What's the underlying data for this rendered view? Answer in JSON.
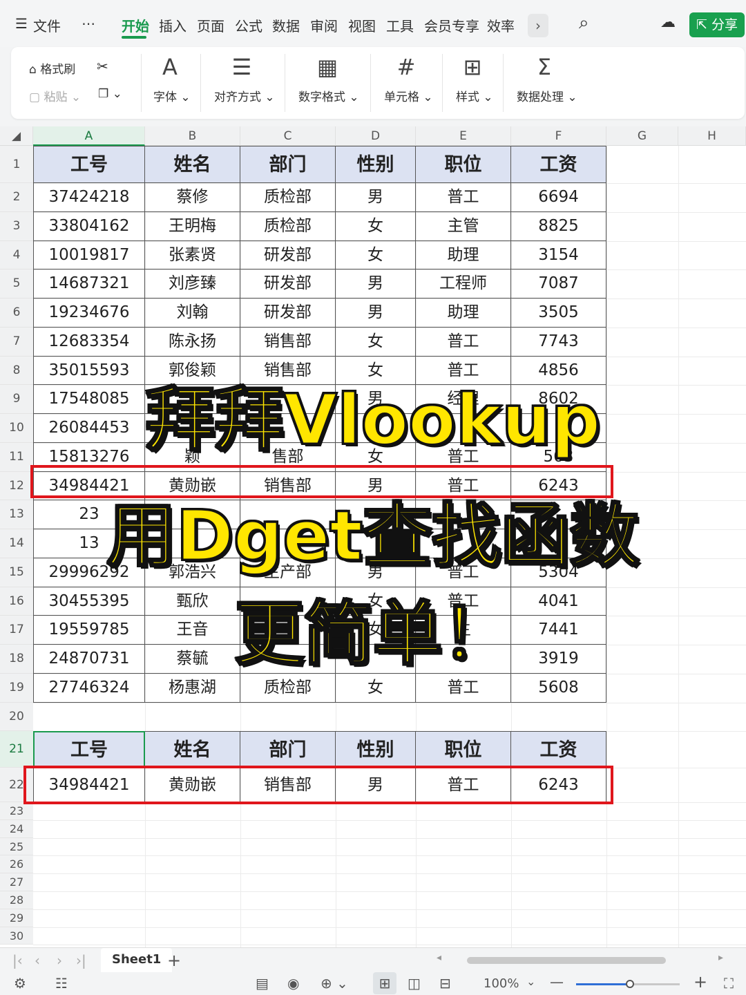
{
  "menu": {
    "file_label": "文件",
    "more_label": "⋯",
    "tabs": [
      "开始",
      "插入",
      "页面",
      "公式",
      "数据",
      "审阅",
      "视图",
      "工具",
      "会员专享",
      "效率"
    ],
    "active_tab": "开始",
    "share_label": "分享"
  },
  "ribbon": {
    "format_painter": "格式刷",
    "paste": "粘贴",
    "font": "字体",
    "align": "对齐方式",
    "number_format": "数字格式",
    "cell": "单元格",
    "style": "样式",
    "data_process": "数据处理"
  },
  "columns": [
    "A",
    "B",
    "C",
    "D",
    "E",
    "F",
    "G",
    "H"
  ],
  "table": {
    "headers": [
      "工号",
      "姓名",
      "部门",
      "性别",
      "职位",
      "工资"
    ],
    "rows": [
      [
        "37424218",
        "蔡修",
        "质检部",
        "男",
        "普工",
        "6694"
      ],
      [
        "33804162",
        "王明梅",
        "质检部",
        "女",
        "主管",
        "8825"
      ],
      [
        "10019817",
        "张素贤",
        "研发部",
        "女",
        "助理",
        "3154"
      ],
      [
        "14687321",
        "刘彦臻",
        "研发部",
        "男",
        "工程师",
        "7087"
      ],
      [
        "19234676",
        "刘翰",
        "研发部",
        "男",
        "助理",
        "3505"
      ],
      [
        "12683354",
        "陈永扬",
        "销售部",
        "女",
        "普工",
        "7743"
      ],
      [
        "35015593",
        "郭俊颖",
        "销售部",
        "女",
        "普工",
        "4856"
      ],
      [
        "17548085",
        "",
        "",
        "男",
        "经理",
        "8602"
      ],
      [
        "26084453",
        "",
        "",
        "",
        "",
        ""
      ],
      [
        "15813276",
        "颖",
        "售部",
        "女",
        "普工",
        "563"
      ],
      [
        "34984421",
        "黄勋嵌",
        "销售部",
        "男",
        "普工",
        "6243"
      ],
      [
        "23",
        "",
        "",
        "",
        "",
        ""
      ],
      [
        "13",
        "",
        "",
        "",
        "",
        ""
      ],
      [
        "29996292",
        "郭浩兴",
        "生产部",
        "男",
        "普工",
        "5304"
      ],
      [
        "30455395",
        "甄欣",
        "",
        "女",
        "普工",
        "4041"
      ],
      [
        "19559785",
        "王音",
        "",
        "女",
        "主",
        "7441"
      ],
      [
        "24870731",
        "蔡毓",
        "",
        "",
        "",
        "3919"
      ],
      [
        "27746324",
        "杨惠湖",
        "质检部",
        "女",
        "普工",
        "5608"
      ]
    ]
  },
  "lookup": {
    "headers": [
      "工号",
      "姓名",
      "部门",
      "性别",
      "职位",
      "工资"
    ],
    "result": [
      "34984421",
      "黄勋嵌",
      "销售部",
      "男",
      "普工",
      "6243"
    ]
  },
  "overlay": {
    "line1": "拜拜Vlookup",
    "line2": "用Dget查找函数",
    "line3": "更简单！"
  },
  "sheet": {
    "name": "Sheet1",
    "add": "+"
  },
  "status": {
    "zoom": "100%"
  }
}
